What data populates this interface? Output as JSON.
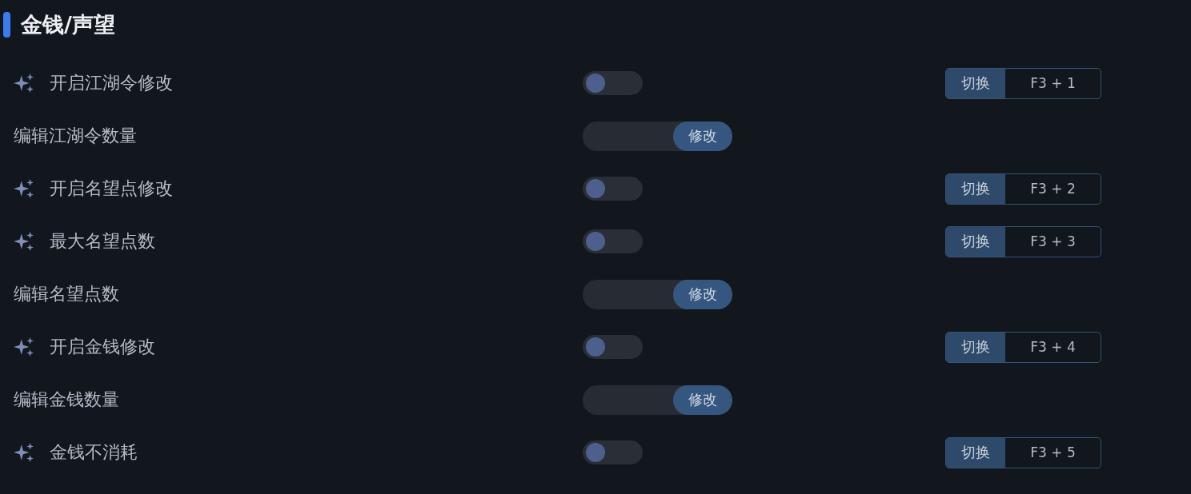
{
  "section": {
    "title": "金钱/声望"
  },
  "rows": [
    {
      "kind": "toggle",
      "label": "开启江湖令修改",
      "on": false,
      "hotkey_label": "切换",
      "hotkey": "F3 + 1"
    },
    {
      "kind": "input",
      "label": "编辑江湖令数量",
      "button": "修改"
    },
    {
      "kind": "toggle",
      "label": "开启名望点修改",
      "on": false,
      "hotkey_label": "切换",
      "hotkey": "F3 + 2"
    },
    {
      "kind": "toggle",
      "label": "最大名望点数",
      "on": false,
      "hotkey_label": "切换",
      "hotkey": "F3 + 3"
    },
    {
      "kind": "input",
      "label": "编辑名望点数",
      "button": "修改"
    },
    {
      "kind": "toggle",
      "label": "开启金钱修改",
      "on": false,
      "hotkey_label": "切换",
      "hotkey": "F3 + 4"
    },
    {
      "kind": "input",
      "label": "编辑金钱数量",
      "button": "修改"
    },
    {
      "kind": "toggle",
      "label": "金钱不消耗",
      "on": false,
      "hotkey_label": "切换",
      "hotkey": "F3 + 5"
    }
  ]
}
